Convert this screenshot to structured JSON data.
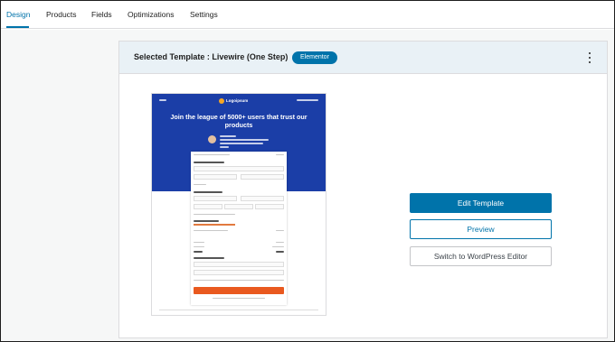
{
  "tabs": [
    {
      "label": "Design",
      "active": true
    },
    {
      "label": "Products"
    },
    {
      "label": "Fields"
    },
    {
      "label": "Optimizations"
    },
    {
      "label": "Settings"
    }
  ],
  "card": {
    "title": "Selected Template :  Livewire  (One Step)",
    "badge": "Elementor",
    "menu_icon": "kebab-menu-icon"
  },
  "preview": {
    "logo": "Logoipsum",
    "headline": "Join the league of 5000+ users that trust our products"
  },
  "actions": {
    "edit": "Edit Template",
    "preview": "Preview",
    "switch": "Switch to WordPress Editor"
  },
  "colors": {
    "accent": "#0073aa",
    "hero": "#1b3ea7",
    "cta": "#e9591f"
  }
}
